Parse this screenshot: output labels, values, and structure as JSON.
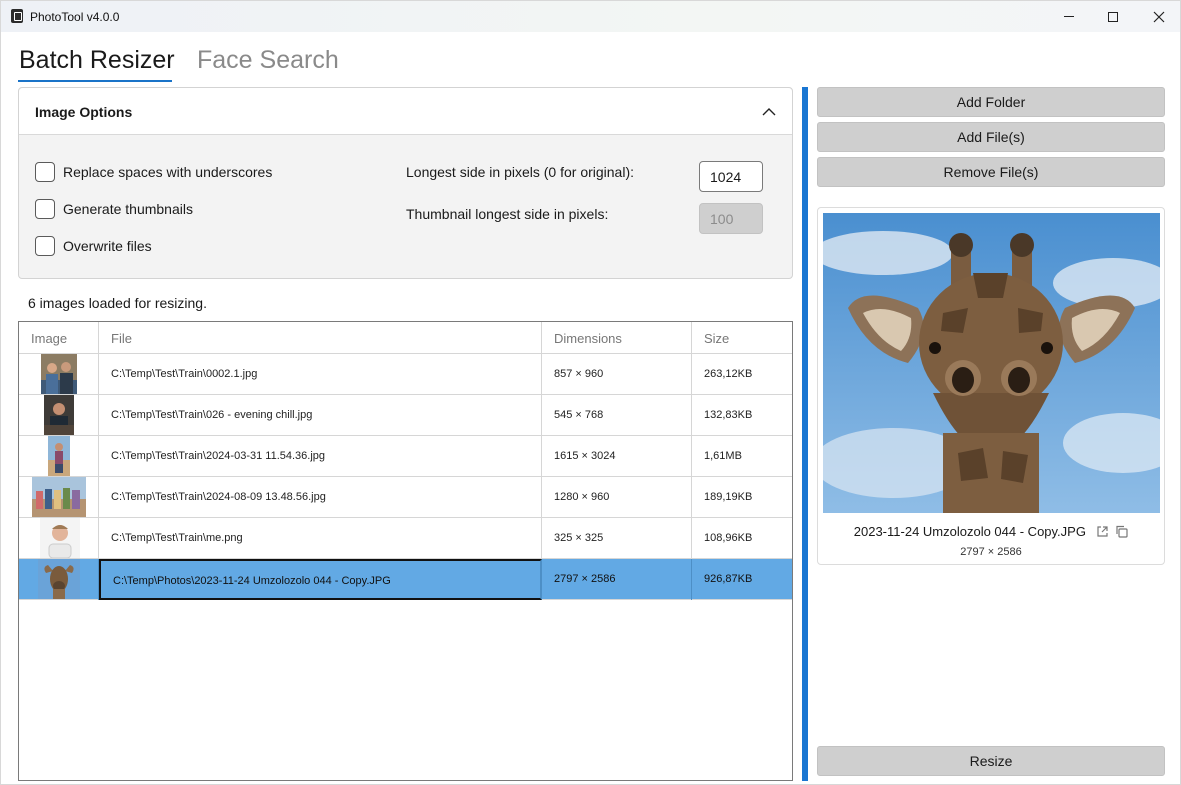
{
  "window": {
    "title": "PhotoTool v4.0.0"
  },
  "tabs": [
    {
      "label": "Batch Resizer",
      "active": true
    },
    {
      "label": "Face Search",
      "active": false
    }
  ],
  "options": {
    "title": "Image Options",
    "checkboxes": [
      {
        "label": "Replace spaces with underscores",
        "checked": false
      },
      {
        "label": "Generate thumbnails",
        "checked": false
      },
      {
        "label": "Overwrite files",
        "checked": false
      }
    ],
    "longest_side_label": "Longest side in pixels (0 for original):",
    "longest_side_value": "1024",
    "thumb_side_label": "Thumbnail longest side in pixels:",
    "thumb_side_value": "100"
  },
  "status": "6 images loaded for resizing.",
  "table": {
    "headers": [
      "Image",
      "File",
      "Dimensions",
      "Size"
    ],
    "rows": [
      {
        "file": "C:\\Temp\\Test\\Train\\0002.1.jpg",
        "dimensions": "857 × 960",
        "size": "263,12KB"
      },
      {
        "file": "C:\\Temp\\Test\\Train\\026 - evening chill.jpg",
        "dimensions": "545 × 768",
        "size": "132,83KB"
      },
      {
        "file": "C:\\Temp\\Test\\Train\\2024-03-31 11.54.36.jpg",
        "dimensions": "1615 × 3024",
        "size": "1,61MB"
      },
      {
        "file": "C:\\Temp\\Test\\Train\\2024-08-09 13.48.56.jpg",
        "dimensions": "1280 × 960",
        "size": "189,19KB"
      },
      {
        "file": "C:\\Temp\\Test\\Train\\me.png",
        "dimensions": "325 × 325",
        "size": "108,96KB"
      },
      {
        "file": "C:\\Temp\\Photos\\2023-11-24 Umzolozolo 044 - Copy.JPG",
        "dimensions": "2797 × 2586",
        "size": "926,87KB",
        "selected": true
      }
    ]
  },
  "actions": {
    "add_folder": "Add Folder",
    "add_files": "Add File(s)",
    "remove_files": "Remove File(s)",
    "resize": "Resize"
  },
  "preview": {
    "filename": "2023-11-24 Umzolozolo 044 - Copy.JPG",
    "dimensions": "2797 × 2586"
  },
  "colors": {
    "accent": "#1976d2",
    "selection": "#62a9e4"
  }
}
